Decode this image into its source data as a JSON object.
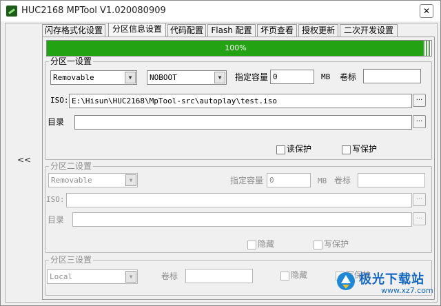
{
  "window": {
    "title": "HUC2168 MPTool V1.020080909",
    "close_label": "✕"
  },
  "sidebar": {
    "collapse_label": "<<"
  },
  "tabs": [
    {
      "label": "闪存格式化设置"
    },
    {
      "label": "分区信息设置"
    },
    {
      "label": "代码配置"
    },
    {
      "label": "Flash 配置"
    },
    {
      "label": "坏页查看"
    },
    {
      "label": "授权更新"
    },
    {
      "label": "二次开发设置"
    }
  ],
  "active_tab": "分区信息设置",
  "progress": {
    "value": 100,
    "label": "100%",
    "color": "#23a313"
  },
  "partition1": {
    "legend": "分区一设置",
    "type_value": "Removable",
    "boot_value": "NOBOOT",
    "capacity_label": "指定容量",
    "capacity_value": "0",
    "unit_label": "MB",
    "volume_label": "卷标",
    "volume_value": "",
    "iso_label": "ISO:",
    "iso_value": "E:\\Hisun\\HUC2168\\MpTool-src\\autoplay\\test.iso",
    "dir_label": "目录",
    "dir_value": "",
    "browse_label": "...",
    "read_protect_label": "读保护",
    "write_protect_label": "写保护"
  },
  "partition2": {
    "legend": "分区二设置",
    "type_value": "Removable",
    "capacity_label": "指定容量",
    "capacity_value": "0",
    "unit_label": "MB",
    "volume_label": "卷标",
    "volume_value": "",
    "iso_label": "ISO:",
    "iso_value": "",
    "dir_label": "目录",
    "dir_value": "",
    "browse_label": "...",
    "hide_label": "隐藏",
    "write_protect_label": "写保护"
  },
  "partition3": {
    "legend": "分区三设置",
    "type_value": "Local",
    "volume_label": "卷标",
    "volume_value": "",
    "hide_label": "隐藏",
    "write_protect_label": "写保护"
  },
  "watermark": {
    "text": "极光下载站",
    "url": "www.xz7.com"
  }
}
